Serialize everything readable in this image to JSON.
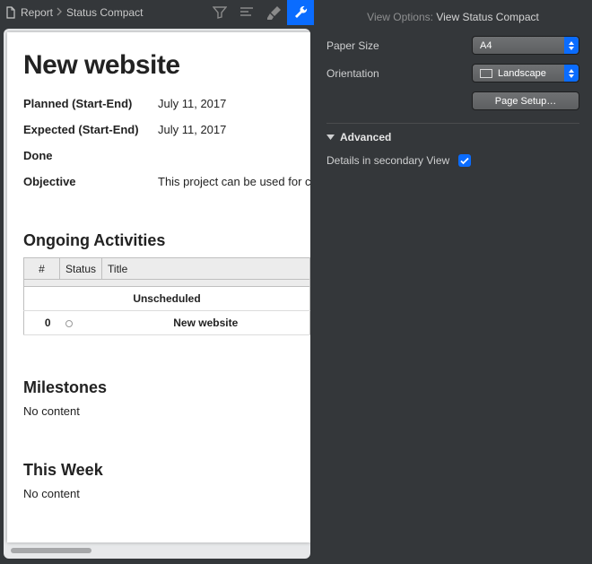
{
  "breadcrumb": {
    "root": "Report",
    "leaf": "Status Compact"
  },
  "toolbar_icons": {
    "filter": "filter-icon",
    "outline": "outline-icon",
    "style": "style-brush-icon",
    "settings": "wrench-icon"
  },
  "report": {
    "title": "New website",
    "meta": [
      {
        "k": "Planned (Start-End)",
        "v": "July 11, 2017"
      },
      {
        "k": "Expected (Start-End)",
        "v": "July 11, 2017"
      },
      {
        "k": "Done",
        "v": ""
      },
      {
        "k": "Objective",
        "v": "This project can be used for creating a website preview that can be presented to your client. Revisions will, of course, be necessary."
      }
    ],
    "sections": {
      "ongoing_title": "Ongoing Activities",
      "milestones_title": "Milestones",
      "milestones_content": "No content",
      "thisweek_title": "This Week",
      "thisweek_content": "No content"
    },
    "table": {
      "headers": {
        "num": "#",
        "status": "Status",
        "title": "Title"
      },
      "group": "Unscheduled",
      "rows": [
        {
          "num": "0",
          "title": "New website"
        }
      ]
    }
  },
  "panel": {
    "header_label": "View Options:",
    "header_value": "View Status Compact",
    "paper_size_label": "Paper Size",
    "paper_size_value": "A4",
    "orientation_label": "Orientation",
    "orientation_value": "Landscape",
    "page_setup_label": "Page Setup…",
    "advanced_label": "Advanced",
    "details_label": "Details in secondary View",
    "details_checked": true
  }
}
